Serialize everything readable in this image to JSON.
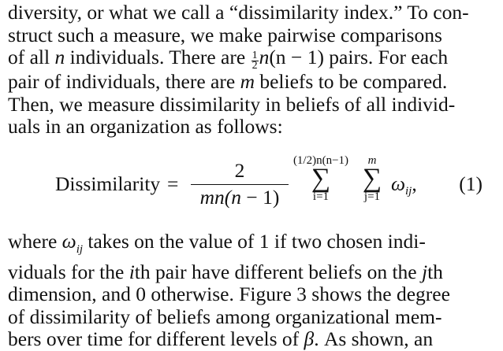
{
  "paragraph_top": {
    "line1": "diversity, or what we call a “dissimilarity index.” To con-",
    "line2": "struct such a measure, we make pairwise comparisons",
    "line3_a": "of all ",
    "line3_n": "n",
    "line3_b": " individuals. There are ",
    "line3_frac_num": "1",
    "line3_frac_den": "2",
    "line3_c": "n",
    "line3_d": "(n",
    "line3_e": " − 1) pairs. For each",
    "line4_a": "pair of individuals, there are ",
    "line4_m": "m",
    "line4_b": " beliefs to be compared.",
    "line5": "Then, we measure dissimilarity in beliefs of all individ-",
    "line6": "uals in an organization as follows:"
  },
  "equation": {
    "lhs": "Dissimilarity",
    "equals": "=",
    "frac_num": "2",
    "frac_den_a": "mn",
    "frac_den_b": "(n",
    "frac_den_c": " − 1)",
    "sum1_top": "(1/2)n(n−1)",
    "sum1_symbol": "∑",
    "sum1_bottom": "i=1",
    "sum2_top": "m",
    "sum2_symbol": "∑",
    "sum2_bottom": "j=1",
    "term": "ω",
    "term_sub": "ij",
    "comma": ",",
    "number": "(1)"
  },
  "paragraph_bottom": {
    "line1_a": "where ",
    "line1_omega": "ω",
    "line1_sub": "ij",
    "line1_b": " takes on the value of 1 if two chosen indi-",
    "line2_a": "viduals for the ",
    "line2_i": "i",
    "line2_b": "th pair have different beliefs on the ",
    "line2_j": "j",
    "line2_c": "th",
    "line3": "dimension, and 0 otherwise. Figure 3 shows the degree",
    "line4": "of dissimilarity of beliefs among organizational mem-",
    "line5_a": "bers over time for different levels of ",
    "line5_beta": "β",
    "line5_b": ". As shown, an"
  }
}
